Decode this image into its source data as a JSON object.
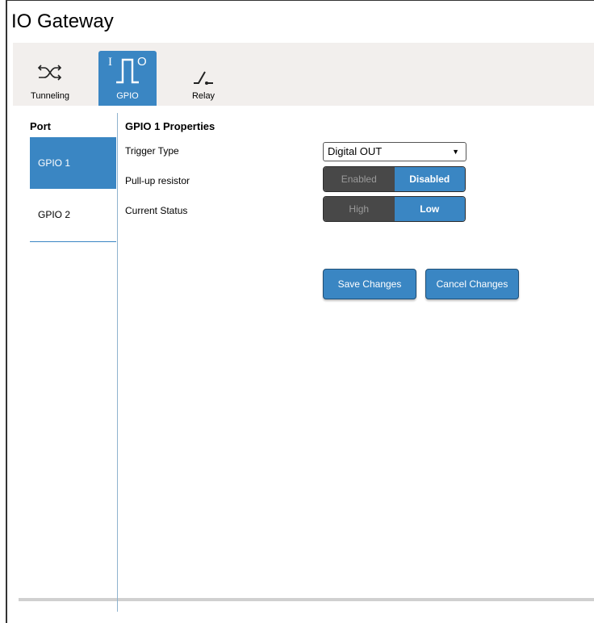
{
  "app": {
    "title": "IO Gateway"
  },
  "tabs": [
    {
      "label": "Tunneling",
      "icon": "shuffle-icon",
      "active": false
    },
    {
      "label": "GPIO",
      "icon": "gpio-pulse-icon",
      "active": true
    },
    {
      "label": "Relay",
      "icon": "relay-switch-icon",
      "active": false
    }
  ],
  "sidebar": {
    "header": "Port",
    "items": [
      {
        "label": "GPIO 1",
        "active": true
      },
      {
        "label": "GPIO 2",
        "active": false
      }
    ]
  },
  "properties": {
    "title": "GPIO 1 Properties",
    "trigger_type": {
      "label": "Trigger Type",
      "value": "Digital OUT"
    },
    "pullup": {
      "label": "Pull-up resistor",
      "options": [
        "Enabled",
        "Disabled"
      ],
      "selected": "Disabled"
    },
    "status": {
      "label": "Current Status",
      "options": [
        "High",
        "Low"
      ],
      "selected": "Low"
    }
  },
  "actions": {
    "save": "Save Changes",
    "cancel": "Cancel Changes"
  },
  "colors": {
    "accent": "#3a86c3",
    "toggle_off": "#484848",
    "tabbar_bg": "#f2efed"
  }
}
